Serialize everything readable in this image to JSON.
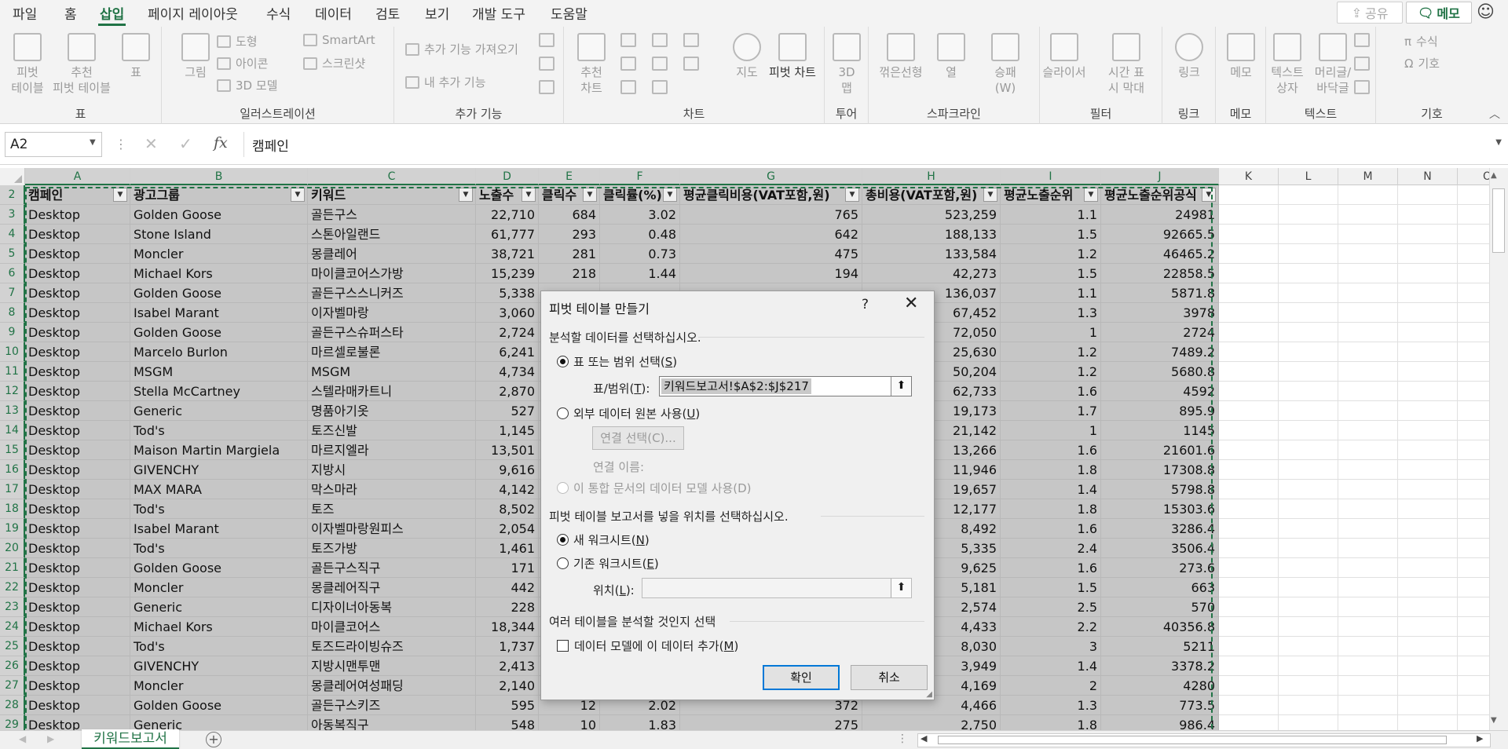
{
  "menu": {
    "tabs": [
      "파일",
      "홈",
      "삽입",
      "페이지 레이아웃",
      "수식",
      "데이터",
      "검토",
      "보기",
      "개발 도구",
      "도움말"
    ],
    "active_index": 2,
    "share_label": "공유",
    "memo_label": "메모"
  },
  "ribbon": {
    "groups": {
      "table": "표",
      "illustrations": "일러스트레이션",
      "addins": "추가 기능",
      "charts": "차트",
      "tours": "투어",
      "sparklines": "스파크라인",
      "filters": "필터",
      "links": "링크",
      "comments": "메모",
      "text": "텍스트",
      "symbols": "기호"
    },
    "buttons": {
      "pivot_table": "피벗\n테이블",
      "recommended_pivot": "추천\n피벗 테이블",
      "table": "표",
      "pictures": "그림",
      "shapes": "도형",
      "icons": "아이콘",
      "models_3d": "3D 모델",
      "smartart": "SmartArt",
      "screenshot": "스크린샷",
      "get_addins": "추가 기능 가져오기",
      "my_addins": "내 추가 기능",
      "recommended_charts": "추천\n차트",
      "maps": "지도",
      "pivot_chart": "피벗 차트",
      "map_3d": "3D\n맵",
      "line": "꺾은선형",
      "column": "열",
      "win_loss": "승패\n(W)",
      "slicer": "슬라이서",
      "timeline": "시간 표\n시 막대",
      "link": "링크",
      "comment": "메모",
      "textbox": "텍스트\n상자",
      "header_footer": "머리글/\n바닥글",
      "equation": "수식",
      "symbol": "기호"
    }
  },
  "formula_bar": {
    "name_box": "A2",
    "formula": "캠페인"
  },
  "columns": [
    "A",
    "B",
    "C",
    "D",
    "E",
    "F",
    "G",
    "H",
    "I",
    "J",
    "K",
    "L",
    "M",
    "N",
    "O"
  ],
  "sheet": {
    "header_row": 2,
    "headers": [
      "캠페인",
      "광고그룹",
      "키워드",
      "노출수",
      "클릭수",
      "클릭률(%)",
      "평균클릭비용(VAT포함,원)",
      "총비용(VAT포함,원)",
      "평균노출순위",
      "평균노출순위공식"
    ],
    "rows": [
      {
        "n": 3,
        "cells": [
          "Desktop",
          "Golden Goose",
          "골든구스",
          "22,710",
          "684",
          "3.02",
          "765",
          "523,259",
          "1.1",
          "24981"
        ]
      },
      {
        "n": 4,
        "cells": [
          "Desktop",
          "Stone Island",
          "스톤아일랜드",
          "61,777",
          "293",
          "0.48",
          "642",
          "188,133",
          "1.5",
          "92665.5"
        ]
      },
      {
        "n": 5,
        "cells": [
          "Desktop",
          "Moncler",
          "몽클레어",
          "38,721",
          "281",
          "0.73",
          "475",
          "133,584",
          "1.2",
          "46465.2"
        ]
      },
      {
        "n": 6,
        "cells": [
          "Desktop",
          "Michael Kors",
          "마이클코어스가방",
          "15,239",
          "218",
          "1.44",
          "194",
          "42,273",
          "1.5",
          "22858.5"
        ]
      },
      {
        "n": 7,
        "cells": [
          "Desktop",
          "Golden Goose",
          "골든구스스니커즈",
          "5,338",
          "",
          "",
          "",
          "136,037",
          "1.1",
          "5871.8"
        ]
      },
      {
        "n": 8,
        "cells": [
          "Desktop",
          "Isabel Marant",
          "이자벨마랑",
          "3,060",
          "",
          "",
          "",
          "67,452",
          "1.3",
          "3978"
        ]
      },
      {
        "n": 9,
        "cells": [
          "Desktop",
          "Golden Goose",
          "골든구스슈퍼스타",
          "2,724",
          "",
          "",
          "",
          "72,050",
          "1",
          "2724"
        ]
      },
      {
        "n": 10,
        "cells": [
          "Desktop",
          "Marcelo Burlon",
          "마르셀로불론",
          "6,241",
          "",
          "",
          "",
          "25,630",
          "1.2",
          "7489.2"
        ]
      },
      {
        "n": 11,
        "cells": [
          "Desktop",
          "MSGM",
          "MSGM",
          "4,734",
          "",
          "",
          "",
          "50,204",
          "1.2",
          "5680.8"
        ]
      },
      {
        "n": 12,
        "cells": [
          "Desktop",
          "Stella McCartney",
          "스텔라매카트니",
          "2,870",
          "",
          "",
          "",
          "62,733",
          "1.6",
          "4592"
        ]
      },
      {
        "n": 13,
        "cells": [
          "Desktop",
          "Generic",
          "명품아기옷",
          "527",
          "",
          "",
          "",
          "19,173",
          "1.7",
          "895.9"
        ]
      },
      {
        "n": 14,
        "cells": [
          "Desktop",
          "Tod's",
          "토즈신발",
          "1,145",
          "",
          "",
          "",
          "21,142",
          "1",
          "1145"
        ]
      },
      {
        "n": 15,
        "cells": [
          "Desktop",
          "Maison Martin Margiela",
          "마르지엘라",
          "13,501",
          "",
          "",
          "",
          "13,266",
          "1.6",
          "21601.6"
        ]
      },
      {
        "n": 16,
        "cells": [
          "Desktop",
          "GIVENCHY",
          "지방시",
          "9,616",
          "",
          "",
          "",
          "11,946",
          "1.8",
          "17308.8"
        ]
      },
      {
        "n": 17,
        "cells": [
          "Desktop",
          "MAX MARA",
          "막스마라",
          "4,142",
          "",
          "",
          "",
          "19,657",
          "1.4",
          "5798.8"
        ]
      },
      {
        "n": 18,
        "cells": [
          "Desktop",
          "Tod's",
          "토즈",
          "8,502",
          "",
          "",
          "",
          "12,177",
          "1.8",
          "15303.6"
        ]
      },
      {
        "n": 19,
        "cells": [
          "Desktop",
          "Isabel Marant",
          "이자벨마랑원피스",
          "2,054",
          "",
          "",
          "",
          "8,492",
          "1.6",
          "3286.4"
        ]
      },
      {
        "n": 20,
        "cells": [
          "Desktop",
          "Tod's",
          "토즈가방",
          "1,461",
          "",
          "",
          "",
          "5,335",
          "2.4",
          "3506.4"
        ]
      },
      {
        "n": 21,
        "cells": [
          "Desktop",
          "Golden Goose",
          "골든구스직구",
          "171",
          "",
          "",
          "",
          "9,625",
          "1.6",
          "273.6"
        ]
      },
      {
        "n": 22,
        "cells": [
          "Desktop",
          "Moncler",
          "몽클레어직구",
          "442",
          "",
          "",
          "",
          "5,181",
          "1.5",
          "663"
        ]
      },
      {
        "n": 23,
        "cells": [
          "Desktop",
          "Generic",
          "디자이너아동복",
          "228",
          "",
          "",
          "",
          "2,574",
          "2.5",
          "570"
        ]
      },
      {
        "n": 24,
        "cells": [
          "Desktop",
          "Michael Kors",
          "마이클코어스",
          "18,344",
          "",
          "",
          "",
          "4,433",
          "2.2",
          "40356.8"
        ]
      },
      {
        "n": 25,
        "cells": [
          "Desktop",
          "Tod's",
          "토즈드라이빙슈즈",
          "1,737",
          "",
          "",
          "",
          "8,030",
          "3",
          "5211"
        ]
      },
      {
        "n": 26,
        "cells": [
          "Desktop",
          "GIVENCHY",
          "지방시맨투맨",
          "2,413",
          "",
          "",
          "",
          "3,949",
          "1.4",
          "3378.2"
        ]
      },
      {
        "n": 27,
        "cells": [
          "Desktop",
          "Moncler",
          "몽클레어여성패딩",
          "2,140",
          "",
          "",
          "",
          "4,169",
          "2",
          "4280"
        ]
      },
      {
        "n": 28,
        "cells": [
          "Desktop",
          "Golden Goose",
          "골든구스키즈",
          "595",
          "12",
          "2.02",
          "372",
          "4,466",
          "1.3",
          "773.5"
        ]
      },
      {
        "n": 29,
        "cells": [
          "Desktop",
          "Generic",
          "아동복직구",
          "548",
          "10",
          "1.83",
          "275",
          "2,750",
          "1.8",
          "986.4"
        ]
      }
    ]
  },
  "sheet_tab": "키워드보고서",
  "dialog": {
    "title": "피벗 테이블 만들기",
    "help": "?",
    "section_data": "분석할 데이터를 선택하십시오.",
    "opt_table_range": "표 또는 범위 선택(",
    "opt_table_range_key": "S",
    "range_label": "표/범위(",
    "range_label_key": "T",
    "range_value": "키워드보고서!$A$2:$J$217",
    "opt_external": "외부 데이터 원본 사용(",
    "opt_external_key": "U",
    "conn_button": "연결 선택(C)...",
    "conn_name_label": "연결 이름:",
    "opt_data_model": "이 통합 문서의 데이터 모델 사용(D)",
    "section_location": "피벗 테이블 보고서를 넣을 위치를 선택하십시오.",
    "opt_new_sheet": "새 워크시트(",
    "opt_new_sheet_key": "N",
    "opt_existing_sheet": "기존 워크시트(",
    "opt_existing_sheet_key": "E",
    "location_label": "위치(",
    "location_label_key": "L",
    "section_multi": "여러 테이블을 분석할 것인지 선택",
    "add_model": "데이터 모델에 이 데이터 추가(",
    "add_model_key": "M",
    "ok": "확인",
    "cancel": "취소"
  }
}
